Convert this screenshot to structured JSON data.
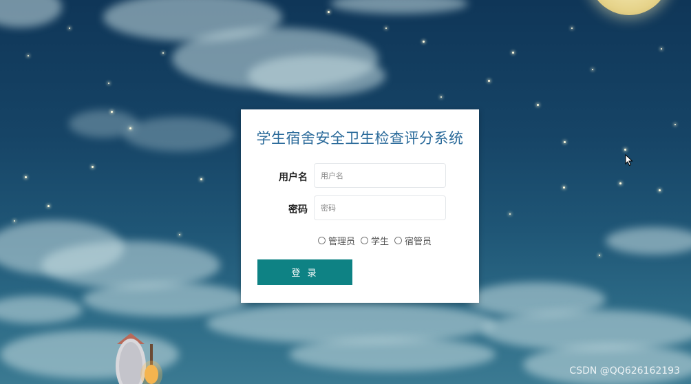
{
  "login": {
    "title": "学生宿舍安全卫生检查评分系统",
    "username_label": "用户名",
    "username_placeholder": "用户名",
    "password_label": "密码",
    "password_placeholder": "密码",
    "roles": [
      "管理员",
      "学生",
      "宿管员"
    ],
    "submit_label": "登 录"
  },
  "watermark": "CSDN @QQ626162193",
  "colors": {
    "title": "#2a6a9a",
    "button": "#0e8284",
    "sky": "#164466"
  },
  "icons": {
    "cursor": "mouse-pointer-icon"
  }
}
